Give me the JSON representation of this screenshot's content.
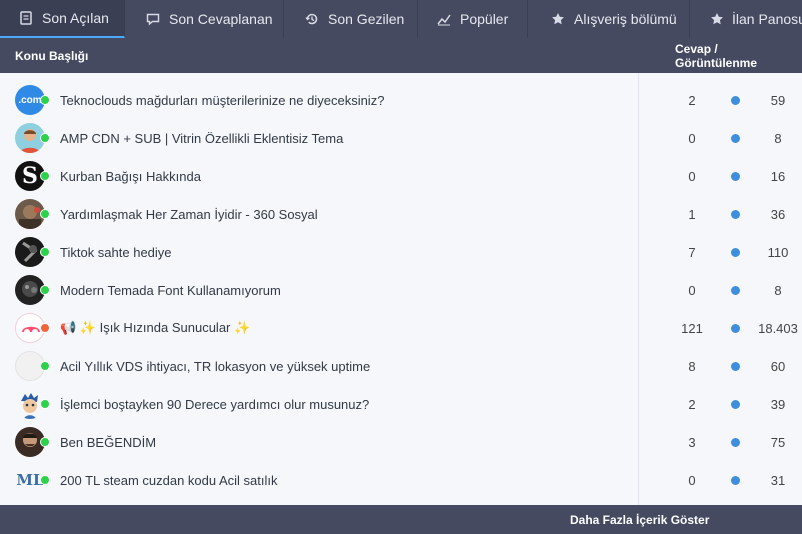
{
  "tabs": [
    {
      "label": "Son Açılan",
      "icon": "document-icon"
    },
    {
      "label": "Son Cevaplanan",
      "icon": "comment-icon"
    },
    {
      "label": "Son Gezilen",
      "icon": "history-icon"
    },
    {
      "label": "Popüler",
      "icon": "trend-icon"
    },
    {
      "label": "Alışveriş bölümü",
      "icon": "star-icon"
    },
    {
      "label": "İlan Panosu",
      "icon": "star-icon"
    }
  ],
  "header": {
    "topic_label": "Konu Başlığı",
    "stats_label": "Cevap / Görüntülenme"
  },
  "threads": [
    {
      "title": "Teknoclouds mağdurları müşterilerinize ne diyeceksiniz?",
      "replies": "2",
      "views": "59",
      "status": "online"
    },
    {
      "title": "AMP CDN + SUB | Vitrin Özellikli Eklentisiz Tema",
      "replies": "0",
      "views": "8",
      "status": "online"
    },
    {
      "title": "Kurban Bağışı Hakkında",
      "replies": "0",
      "views": "16",
      "status": "online"
    },
    {
      "title": "Yardımlaşmak Her Zaman İyidir - 360 Sosyal",
      "replies": "1",
      "views": "36",
      "status": "online"
    },
    {
      "title": "Tiktok sahte hediye",
      "replies": "7",
      "views": "110",
      "status": "online"
    },
    {
      "title": "Modern Temada Font Kullanamıyorum",
      "replies": "0",
      "views": "8",
      "status": "online"
    },
    {
      "title": "📢 ✨ Işık Hızında Sunucular ✨",
      "replies": "121",
      "views": "18.403",
      "status": "away"
    },
    {
      "title": "Acil Yıllık VDS ihtiyacı, TR lokasyon ve yüksek uptime",
      "replies": "8",
      "views": "60",
      "status": "online"
    },
    {
      "title": "İşlemci boştayken 90 Derece yardımcı olur musunuz?",
      "replies": "2",
      "views": "39",
      "status": "online"
    },
    {
      "title": "Ben BEĞENDİM",
      "replies": "3",
      "views": "75",
      "status": "online"
    },
    {
      "title": "200 TL steam cuzdan kodu Acil satılık",
      "replies": "0",
      "views": "31",
      "status": "online"
    }
  ],
  "avatar_texts": {
    "com": ".com",
    "s": "S",
    "ml": "ML"
  },
  "footer": {
    "more_label": "Daha Fazla İçerik Göster"
  },
  "colors": {
    "bar": "#464a60",
    "accent": "#4aa8ff",
    "dot": "#3e8ede",
    "online": "#2bd24a",
    "away": "#f2653a"
  }
}
